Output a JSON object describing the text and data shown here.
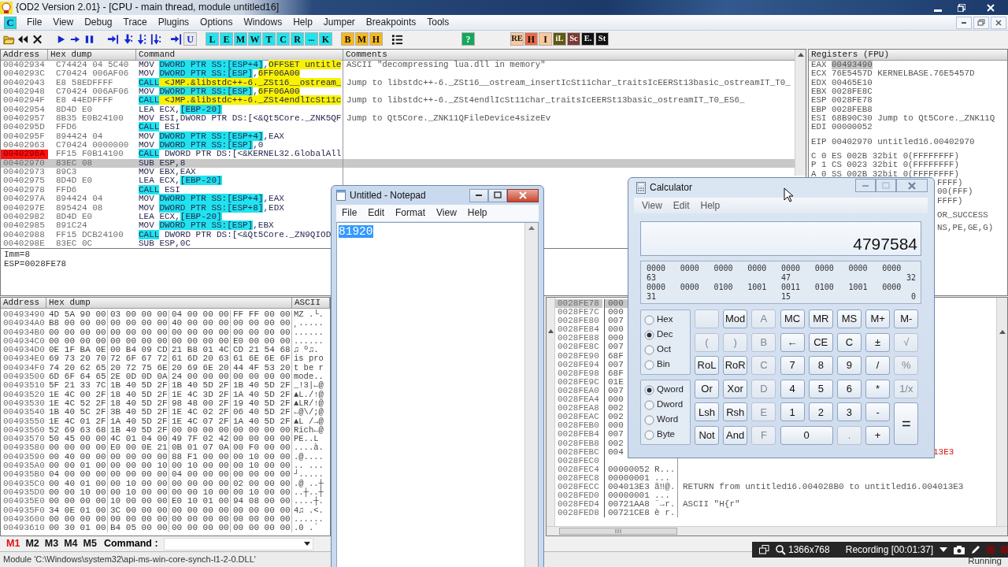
{
  "window": {
    "title": "{OD2 Version 2.01} - [CPU - main thread, module untitled16]"
  },
  "menu_badge": "C",
  "menus": [
    "File",
    "View",
    "Debug",
    "Trace",
    "Plugins",
    "Options",
    "Windows",
    "Help",
    "Jumper",
    "Breakpoints",
    "Tools"
  ],
  "toolbar": [
    {
      "label": "U",
      "color": "#e9e9e9"
    },
    {
      "label": "L",
      "color": "#22e4ee"
    },
    {
      "label": "E",
      "color": "#22e4ee"
    },
    {
      "label": "M",
      "color": "#22e4ee"
    },
    {
      "label": "W",
      "color": "#22e4ee"
    },
    {
      "label": "T",
      "color": "#22e4ee"
    },
    {
      "label": "C",
      "color": "#22e4ee"
    },
    {
      "label": "R",
      "color": "#22e4ee"
    },
    {
      "label": "...",
      "color": "#22e4ee"
    },
    {
      "label": "K",
      "color": "#22e4ee"
    },
    {
      "label": "B",
      "color": "#f8b81a"
    },
    {
      "label": "M",
      "color": "#f8b81a"
    },
    {
      "label": "H",
      "color": "#f8b81a"
    },
    {
      "label": "?",
      "color": "#14a85a"
    },
    {
      "label": "RE",
      "color": "#fbc89c"
    },
    {
      "label": "H",
      "color": "#ee6846"
    },
    {
      "label": "I",
      "color": "#fbc89c"
    },
    {
      "label": "iL",
      "color": "#5e5a10"
    },
    {
      "label": "Sc",
      "color": "#7c3a34"
    },
    {
      "label": "E.",
      "color": "#111111"
    },
    {
      "label": "St",
      "color": "#111111"
    }
  ],
  "disasm": {
    "columns": [
      "Address",
      "Hex dump",
      "Command"
    ],
    "comments_title": "Comments",
    "rows": [
      {
        "address": "00402934",
        "hex": "C74424 04 5C40",
        "command": [
          {
            "t": "MOV "
          },
          {
            "t": "DWORD PTR SS:[ESP+4]",
            "kind": "mem"
          },
          {
            "t": ","
          },
          {
            "t": "OFFSET untitle",
            "kind": "sym"
          }
        ],
        "comment": "ASCII \"decompressing lua.dll in memory\"",
        "selected": false,
        "breakpoint": false
      },
      {
        "address": "0040293C",
        "hex": "C70424 006AF06",
        "command": [
          {
            "t": "MOV "
          },
          {
            "t": "DWORD PTR SS:[ESP]",
            "kind": "mem"
          },
          {
            "t": ","
          },
          {
            "t": "6FF06A00",
            "kind": "sym"
          }
        ],
        "selected": false,
        "breakpoint": false
      },
      {
        "address": "00402943",
        "hex": "E8 58EDFFFF",
        "command": [
          {
            "t": "CALL",
            "kind": "mem"
          },
          {
            "t": " <JMP.&libstdc++-6._ZSt16__ostream_",
            "kind": "sym"
          }
        ],
        "comment": "Jump to libstdc++-6._ZSt16__ostream_insertIcSt11char_traitsIcEERSt13basic_ostreamIT_T0_",
        "selected": false,
        "breakpoint": false
      },
      {
        "address": "00402948",
        "hex": "C70424 006AF06",
        "command": [
          {
            "t": "MOV "
          },
          {
            "t": "DWORD PTR SS:[ESP]",
            "kind": "mem"
          },
          {
            "t": ","
          },
          {
            "t": "6FF06A00",
            "kind": "sym"
          }
        ],
        "selected": false,
        "breakpoint": false
      },
      {
        "address": "0040294F",
        "hex": "E8 44EDFFFF",
        "command": [
          {
            "t": "CALL",
            "kind": "mem"
          },
          {
            "t": " <JMP.&libstdc++-6._ZSt4endlIcSt11c",
            "kind": "sym"
          }
        ],
        "comment": "Jump to libstdc++-6._ZSt4endlIcSt11char_traitsIcEERSt13basic_ostreamIT_T0_ES6_",
        "selected": false,
        "breakpoint": false
      },
      {
        "address": "00402954",
        "hex": "8D4D E0",
        "command": [
          {
            "t": "LEA ECX,"
          },
          {
            "t": "[EBP-20]",
            "kind": "mem"
          }
        ],
        "selected": false,
        "breakpoint": false
      },
      {
        "address": "00402957",
        "hex": "8B35 E0B24100",
        "command": [
          {
            "t": "MOV ESI,DWORD PTR DS:[<&Qt5Core._ZNK5QF"
          }
        ],
        "comment": "Jump to Qt5Core._ZNK11QFileDevice4sizeEv",
        "selected": false,
        "breakpoint": false
      },
      {
        "address": "0040295D",
        "hex": "FFD6",
        "command": [
          {
            "t": "CALL",
            "kind": "mem"
          },
          {
            "t": " ESI"
          }
        ],
        "selected": false,
        "breakpoint": false
      },
      {
        "address": "0040295F",
        "hex": "894424 04",
        "command": [
          {
            "t": "MOV "
          },
          {
            "t": "DWORD PTR SS:[ESP+4]",
            "kind": "mem"
          },
          {
            "t": ",EAX"
          }
        ],
        "selected": false,
        "breakpoint": false
      },
      {
        "address": "00402963",
        "hex": "C70424 0000000",
        "command": [
          {
            "t": "MOV "
          },
          {
            "t": "DWORD PTR SS:[ESP]",
            "kind": "mem"
          },
          {
            "t": ",0"
          }
        ],
        "selected": false,
        "breakpoint": false
      },
      {
        "address": "0040296A",
        "hex": "FF15 F0B14100",
        "command": [
          {
            "t": "CALL",
            "kind": "mem"
          },
          {
            "t": " DWORD PTR DS:[<&KERNEL32.GlobalAll"
          }
        ],
        "selected": false,
        "breakpoint": true
      },
      {
        "address": "00402970",
        "hex": "83EC 08",
        "command": [
          {
            "t": "SUB ESP,8"
          }
        ],
        "selected": true,
        "breakpoint": false
      },
      {
        "address": "00402973",
        "hex": "89C3",
        "command": [
          {
            "t": "MOV EBX,EAX"
          }
        ],
        "selected": false,
        "breakpoint": false
      },
      {
        "address": "00402975",
        "hex": "8D4D E0",
        "command": [
          {
            "t": "LEA ECX,"
          },
          {
            "t": "[EBP-20]",
            "kind": "mem"
          }
        ],
        "selected": false,
        "breakpoint": false
      },
      {
        "address": "00402978",
        "hex": "FFD6",
        "command": [
          {
            "t": "CALL",
            "kind": "mem"
          },
          {
            "t": " ESI"
          }
        ],
        "selected": false,
        "breakpoint": false
      },
      {
        "address": "0040297A",
        "hex": "894424 04",
        "command": [
          {
            "t": "MOV "
          },
          {
            "t": "DWORD PTR SS:[ESP+4]",
            "kind": "mem"
          },
          {
            "t": ",EAX"
          }
        ],
        "selected": false,
        "breakpoint": false
      },
      {
        "address": "0040297E",
        "hex": "895424 08",
        "command": [
          {
            "t": "MOV "
          },
          {
            "t": "DWORD PTR SS:[ESP+8]",
            "kind": "mem"
          },
          {
            "t": ",EDX"
          }
        ],
        "selected": false,
        "breakpoint": false
      },
      {
        "address": "00402982",
        "hex": "8D4D E0",
        "command": [
          {
            "t": "LEA ECX,"
          },
          {
            "t": "[EBP-20]",
            "kind": "mem"
          }
        ],
        "selected": false,
        "breakpoint": false
      },
      {
        "address": "00402985",
        "hex": "891C24",
        "command": [
          {
            "t": "MOV "
          },
          {
            "t": "DWORD PTR SS:[ESP]",
            "kind": "mem"
          },
          {
            "t": ",EBX"
          }
        ],
        "selected": false,
        "breakpoint": false
      },
      {
        "address": "00402988",
        "hex": "FF15 DCB24100",
        "command": [
          {
            "t": "CALL",
            "kind": "mem"
          },
          {
            "t": " DWORD PTR DS:[<&Qt5Core._ZN9QIOD"
          }
        ],
        "selected": false,
        "breakpoint": false
      },
      {
        "address": "0040298E",
        "hex": "83EC 0C",
        "command": [
          {
            "t": "SUB ESP,0C"
          }
        ],
        "selected": false,
        "breakpoint": false
      }
    ]
  },
  "info": [
    "Imm=8",
    "ESP=0028FE78"
  ],
  "registers": {
    "title": "Registers (FPU)",
    "groups": [
      [
        {
          "name": "EAX",
          "value": "00493490",
          "selected": true
        },
        {
          "name": "ECX",
          "value": "76E5457D",
          "note": "KERNELBASE.76E5457D",
          "selected": false
        },
        {
          "name": "EDX",
          "value": "00465E10",
          "selected": false
        },
        {
          "name": "EBX",
          "value": "0028FE8C",
          "selected": false
        },
        {
          "name": "ESP",
          "value": "0028FE78",
          "selected": false
        },
        {
          "name": "EBP",
          "value": "0028FEB8",
          "selected": false
        },
        {
          "name": "ESI",
          "value": "68B90C30",
          "note": "Jump to Qt5Core._ZNK11Q",
          "selected": false
        },
        {
          "name": "EDI",
          "value": "00000052",
          "selected": false
        }
      ],
      [
        {
          "name": "EIP",
          "value": "00402970",
          "note": "untitled16.00402970",
          "selected": false
        }
      ],
      [
        {
          "text": "C 0  ES 002B 32bit 0(FFFFFFFF)"
        },
        {
          "text": "P 1  CS 0023 32bit 0(FFFFFFFF)"
        },
        {
          "text": "A 0  SS 002B 32bit 0(FFFFFFFF)"
        },
        {
          "text": "FFFF)",
          "kind": "tail"
        },
        {
          "text": "00(FFF)",
          "kind": "tail"
        },
        {
          "text": "FFFF)",
          "kind": "tail"
        }
      ],
      [
        {
          "text": "OR_SUCCESS",
          "kind": "tail"
        }
      ],
      [
        {
          "text": "NS,PE,GE,G)",
          "kind": "tail"
        }
      ]
    ]
  },
  "dump": {
    "columns": [
      "Address",
      "Hex dump",
      "ASCII"
    ],
    "rows": [
      {
        "address": "00493490",
        "bytes": [
          "4D 5A 90 00",
          "03 00 00 00",
          "04 00 00 00",
          "FF FF 00 00"
        ],
        "ascii": "MZ .└."
      },
      {
        "address": "004934A0",
        "bytes": [
          "B8 00 00 00",
          "00 00 00 00",
          "40 00 00 00",
          "00 00 00 00"
        ],
        "ascii": "¸....."
      },
      {
        "address": "004934B0",
        "bytes": [
          "00 00 00 00",
          "00 00 00 00",
          "00 00 00 00",
          "00 00 00 00"
        ],
        "ascii": "......"
      },
      {
        "address": "004934C0",
        "bytes": [
          "00 00 00 00",
          "00 00 00 00",
          "00 00 00 00",
          "E0 00 00 00"
        ],
        "ascii": "......"
      },
      {
        "address": "004934D0",
        "bytes": [
          "0E 1F BA 0E",
          "00 B4 09 CD",
          "21 B8 01 4C",
          "CD 21 54 68"
        ],
        "ascii": "♫ º♫."
      },
      {
        "address": "004934E0",
        "bytes": [
          "69 73 20 70",
          "72 6F 67 72",
          "61 6D 20 63",
          "61 6E 6E 6F"
        ],
        "ascii": "is pro"
      },
      {
        "address": "004934F0",
        "bytes": [
          "74 20 62 65",
          "20 72 75 6E",
          "20 69 6E 20",
          "44 4F 53 20"
        ],
        "ascii": "t be r"
      },
      {
        "address": "00493500",
        "bytes": [
          "6D 6F 64 65",
          "2E 0D 0D 0A",
          "24 00 00 00",
          "00 00 00 00"
        ],
        "ascii": "mode.."
      },
      {
        "address": "00493510",
        "bytes": [
          "5F 21 33 7C",
          "1B 40 5D 2F",
          "1B 40 5D 2F",
          "1B 40 5D 2F"
        ],
        "ascii": "_!3|←@"
      },
      {
        "address": "00493520",
        "bytes": [
          "1E 4C 00 2F",
          "18 40 5D 2F",
          "1E 4C 3D 2F",
          "1A 40 5D 2F"
        ],
        "ascii": "▲L./↑@"
      },
      {
        "address": "00493530",
        "bytes": [
          "1E 4C 52 2F",
          "18 40 5D 2F",
          "98 48 00 2F",
          "19 40 5D 2F"
        ],
        "ascii": "▲LR/↑@"
      },
      {
        "address": "00493540",
        "bytes": [
          "1B 40 5C 2F",
          "3B 40 5D 2F",
          "1E 4C 02 2F",
          "06 40 5D 2F"
        ],
        "ascii": "←@\\/;@"
      },
      {
        "address": "00493550",
        "bytes": [
          "1E 4C 01 2F",
          "1A 40 5D 2F",
          "1E 4C 07 2F",
          "1A 40 5D 2F"
        ],
        "ascii": "▲L /→@"
      },
      {
        "address": "00493560",
        "bytes": [
          "52 69 63 68",
          "1B 40 5D 2F",
          "00 00 00 00",
          "00 00 00 00"
        ],
        "ascii": "Rich←@"
      },
      {
        "address": "00493570",
        "bytes": [
          "50 45 00 00",
          "4C 01 04 00",
          "49 7F 02 42",
          "00 00 00 00"
        ],
        "ascii": "PE..L"
      },
      {
        "address": "00493580",
        "bytes": [
          "00 00 00 00",
          "E0 00 0E 21",
          "0B 01 07 0A",
          "00 F0 00 00"
        ],
        "ascii": "....à."
      },
      {
        "address": "00493590",
        "bytes": [
          "00 40 00 00",
          "00 00 00 00",
          "88 F1 00 00",
          "00 10 00 00"
        ],
        "ascii": ".@...."
      },
      {
        "address": "004935A0",
        "bytes": [
          "00 00 01 00",
          "00 00 00 10",
          "00 10 00 00",
          "00 10 00 00"
        ],
        "ascii": ".. ..."
      },
      {
        "address": "004935B0",
        "bytes": [
          "04 00 00 00",
          "00 00 00 00",
          "04 00 00 00",
          "00 00 00 00"
        ],
        "ascii": "┘....."
      },
      {
        "address": "004935C0",
        "bytes": [
          "00 40 01 00",
          "00 10 00 00",
          "00 00 00 00",
          "02 00 00 00"
        ],
        "ascii": ".@ ..┼"
      },
      {
        "address": "004935D0",
        "bytes": [
          "00 00 10 00",
          "00 10 00 00",
          "00 00 10 00",
          "00 10 00 00"
        ],
        "ascii": "..┼..┼"
      },
      {
        "address": "004935E0",
        "bytes": [
          "00 00 00 00",
          "10 00 00 00",
          "E0 10 01 00",
          "94 08 00 00"
        ],
        "ascii": "....┼."
      },
      {
        "address": "004935F0",
        "bytes": [
          "34 0E 01 00",
          "3C 00 00 00",
          "00 00 00 00",
          "00 00 00 00"
        ],
        "ascii": "4♫ .<."
      },
      {
        "address": "00493600",
        "bytes": [
          "00 00 00 00",
          "00 00 00 00",
          "00 00 00 00",
          "00 00 00 00"
        ],
        "ascii": "......"
      },
      {
        "address": "00493610",
        "bytes": [
          "00 30 01 00",
          "B4 05 00 00",
          "00 00 00 00",
          "00 00 00 00"
        ],
        "ascii": ".0 .´"
      }
    ]
  },
  "stack": {
    "rows": [
      {
        "address": "0028FE78",
        "value": "000",
        "selected": true
      },
      {
        "address": "0028FE7C",
        "value": "000",
        "selected": false
      },
      {
        "address": "0028FE80",
        "value": "007",
        "selected": false
      },
      {
        "address": "0028FE84",
        "value": "000",
        "selected": false
      },
      {
        "address": "0028FE88",
        "value": "000",
        "selected": false
      },
      {
        "address": "0028FE8C",
        "value": "007",
        "selected": false
      },
      {
        "address": "0028FE90",
        "value": "68F",
        "selected": false
      },
      {
        "address": "0028FE94",
        "value": "007",
        "selected": false
      },
      {
        "address": "0028FE98",
        "value": "68F",
        "selected": false
      },
      {
        "address": "0028FE9C",
        "value": "01E",
        "selected": false
      },
      {
        "address": "0028FEA0",
        "value": "007",
        "selected": false
      },
      {
        "address": "0028FEA4",
        "value": "000",
        "selected": false
      },
      {
        "address": "0028FEA8",
        "value": "002",
        "selected": false
      },
      {
        "address": "0028FEAC",
        "value": "002",
        "selected": false
      },
      {
        "address": "0028FEB0",
        "value": "000",
        "selected": false
      },
      {
        "address": "0028FEB4",
        "value": "007",
        "selected": false
      },
      {
        "address": "0028FEB8",
        "value": "002",
        "selected": false
      },
      {
        "address": "0028FEBC",
        "value": "004",
        "comment_tail": "13E3",
        "selected": false
      },
      {
        "address": "0028FEC0",
        "selected": false
      },
      {
        "address": "0028FEC4",
        "value": "00000052",
        "ascii": "R...",
        "selected": false
      },
      {
        "address": "0028FEC8",
        "value": "00000001",
        "ascii": "...",
        "selected": false
      },
      {
        "address": "0028FECC",
        "value": "004013E3",
        "ascii": "ã‼@.",
        "comment": "RETURN from untitled16.004028B0 to untitled16.004013E3",
        "selected": false
      },
      {
        "address": "0028FED0",
        "value": "00000001",
        "ascii": "...",
        "selected": false
      },
      {
        "address": "0028FED4",
        "value": "00721AA8",
        "ascii": "¨→r.",
        "comment": "ASCII \"H{r\"",
        "selected": false
      },
      {
        "address": "0028FED8",
        "value": "00721CE8",
        "ascii": "è r.",
        "selected": false
      }
    ]
  },
  "command_bar": {
    "marks": [
      {
        "label": "M1",
        "selected": true
      },
      {
        "label": "M2",
        "selected": false
      },
      {
        "label": "M3",
        "selected": false
      },
      {
        "label": "M4",
        "selected": false
      },
      {
        "label": "M5",
        "selected": false
      }
    ],
    "label": "Command :"
  },
  "status_bar": {
    "text": "Module 'C:\\Windows\\system32\\api-ms-win-core-synch-l1-2-0.DLL'",
    "state": "Running"
  },
  "recorder": {
    "resolution": "1366x768",
    "recording": "Recording [00:01:37]"
  },
  "notepad": {
    "title": "Untitled - Notepad",
    "menus": [
      "File",
      "Edit",
      "Format",
      "View",
      "Help"
    ],
    "text": "81920",
    "selected": true
  },
  "calculator": {
    "title": "Calculator",
    "menus": [
      "View",
      "Edit",
      "Help"
    ],
    "display": "4797584",
    "bits": [
      {
        "groups": [
          "0000",
          "0000",
          "0000",
          "0000",
          "0000",
          "0000",
          "0000",
          "0000"
        ],
        "labels": [
          "63",
          "47",
          "32"
        ]
      },
      {
        "groups": [
          "0000",
          "0000",
          "0100",
          "1001",
          "0011",
          "0100",
          "1001",
          "0000"
        ],
        "labels": [
          "31",
          "15",
          "0"
        ]
      }
    ],
    "bases": [
      {
        "label": "Hex",
        "selected": false
      },
      {
        "label": "Dec",
        "selected": true
      },
      {
        "label": "Oct",
        "selected": false
      },
      {
        "label": "Bin",
        "selected": false
      }
    ],
    "sizes": [
      {
        "label": "Qword",
        "selected": true
      },
      {
        "label": "Dword",
        "selected": false
      },
      {
        "label": "Word",
        "selected": false
      },
      {
        "label": "Byte",
        "selected": false
      }
    ],
    "keys": [
      {
        "kind": "blank",
        "disabled": true
      },
      {
        "label": "Mod",
        "disabled": false
      },
      {
        "label": "A",
        "disabled": true
      },
      {
        "label": "MC",
        "disabled": false
      },
      {
        "label": "MR",
        "disabled": false
      },
      {
        "label": "MS",
        "disabled": false
      },
      {
        "label": "M+",
        "disabled": false
      },
      {
        "label": "M-",
        "disabled": false
      },
      {
        "label": "(",
        "disabled": true
      },
      {
        "label": ")",
        "disabled": true
      },
      {
        "label": "B",
        "disabled": true
      },
      {
        "label": "←",
        "disabled": false
      },
      {
        "label": "CE",
        "disabled": false
      },
      {
        "label": "C",
        "disabled": false
      },
      {
        "label": "±",
        "disabled": false
      },
      {
        "label": "√",
        "disabled": true
      },
      {
        "label": "RoL",
        "disabled": false
      },
      {
        "label": "RoR",
        "disabled": false
      },
      {
        "label": "C",
        "disabled": true
      },
      {
        "label": "7",
        "disabled": false
      },
      {
        "label": "8",
        "disabled": false
      },
      {
        "label": "9",
        "disabled": false
      },
      {
        "label": "/",
        "disabled": false
      },
      {
        "label": "%",
        "disabled": true
      },
      {
        "label": "Or",
        "disabled": false
      },
      {
        "label": "Xor",
        "disabled": false
      },
      {
        "label": "D",
        "disabled": true
      },
      {
        "label": "4",
        "disabled": false
      },
      {
        "label": "5",
        "disabled": false
      },
      {
        "label": "6",
        "disabled": false
      },
      {
        "label": "*",
        "disabled": false
      },
      {
        "label": "1/x",
        "disabled": true
      },
      {
        "label": "Lsh",
        "disabled": false
      },
      {
        "label": "Rsh",
        "disabled": false
      },
      {
        "label": "E",
        "disabled": true
      },
      {
        "label": "1",
        "disabled": false
      },
      {
        "label": "2",
        "disabled": false
      },
      {
        "label": "3",
        "disabled": false
      },
      {
        "label": "-",
        "disabled": false
      },
      {
        "label": "=",
        "kind": "tall",
        "disabled": false
      },
      {
        "label": "Not",
        "disabled": false
      },
      {
        "label": "And",
        "disabled": false
      },
      {
        "label": "F",
        "disabled": true
      },
      {
        "label": "0",
        "kind": "wide",
        "disabled": false
      },
      {
        "label": ".",
        "disabled": true
      },
      {
        "label": "+",
        "disabled": false
      }
    ]
  }
}
